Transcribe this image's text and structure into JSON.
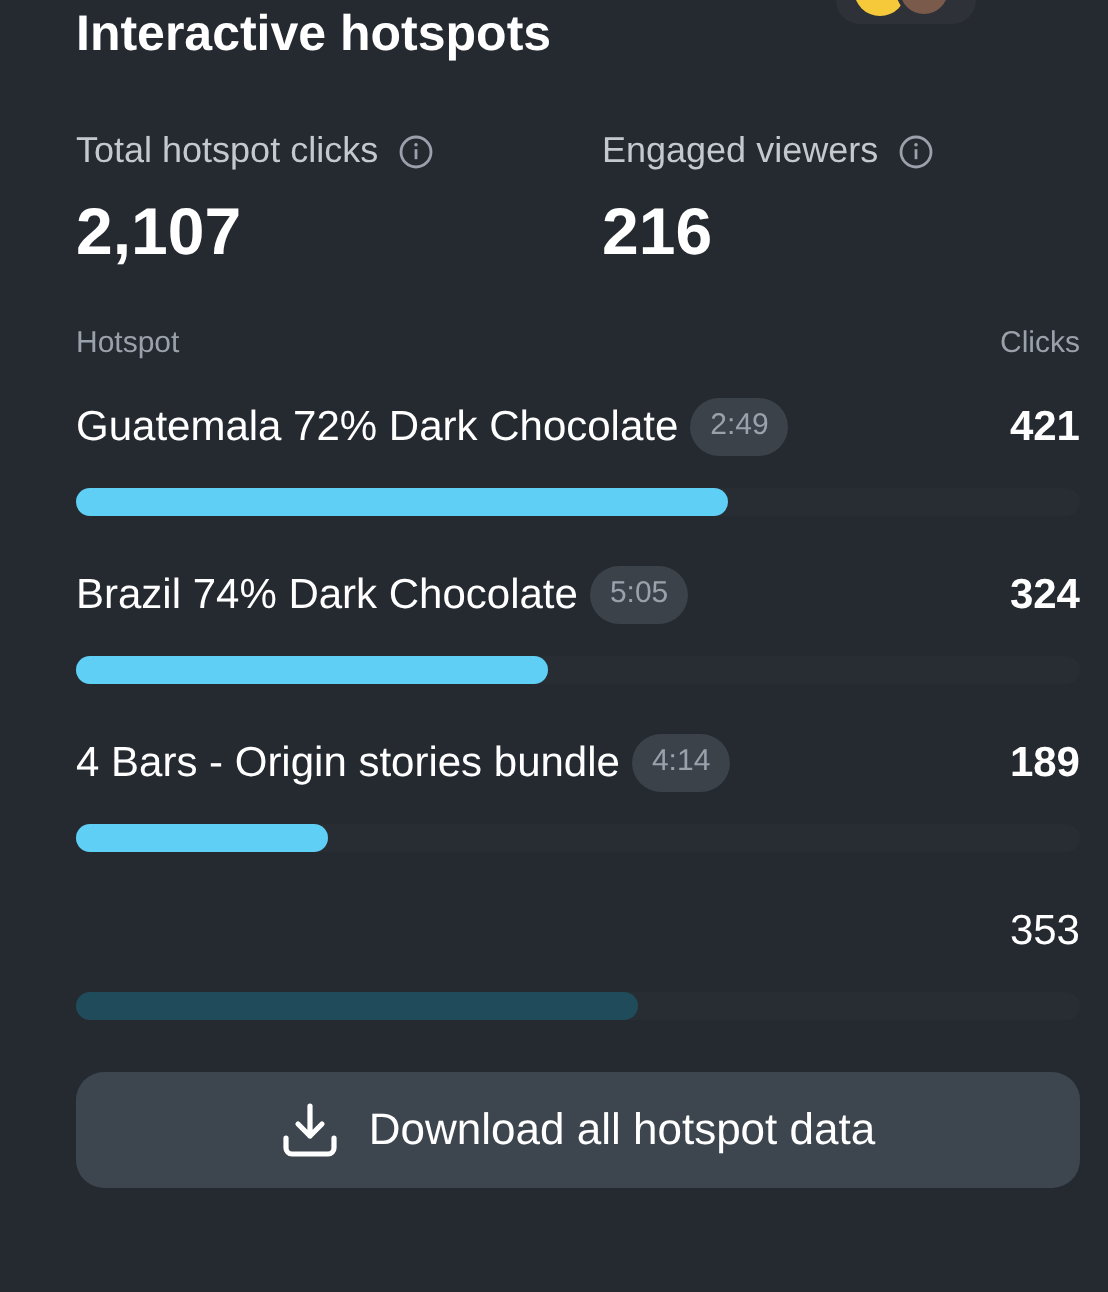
{
  "title": "Interactive hotspots",
  "stats": [
    {
      "label": "Total hotspot clicks",
      "value": "2,107"
    },
    {
      "label": "Engaged viewers",
      "value": "216"
    }
  ],
  "table": {
    "columns": [
      "Hotspot",
      "Clicks"
    ],
    "rows": [
      {
        "kind": "hotspot",
        "name": "Guatemala 72% Dark Chocolate",
        "time": "2:49",
        "clicks": "421",
        "level": 0.65
      },
      {
        "kind": "hotspot",
        "name": "Brazil 74% Dark Chocolate",
        "time": "5:05",
        "clicks": "324",
        "level": 0.47
      },
      {
        "kind": "hotspot",
        "name": "4 Bars - Origin stories bundle",
        "time": "4:14",
        "clicks": "189",
        "level": 0.25
      },
      {
        "kind": "muted",
        "clicks": "353",
        "level": 0.56
      }
    ]
  },
  "button": {
    "label": "Download all hotspot data"
  }
}
